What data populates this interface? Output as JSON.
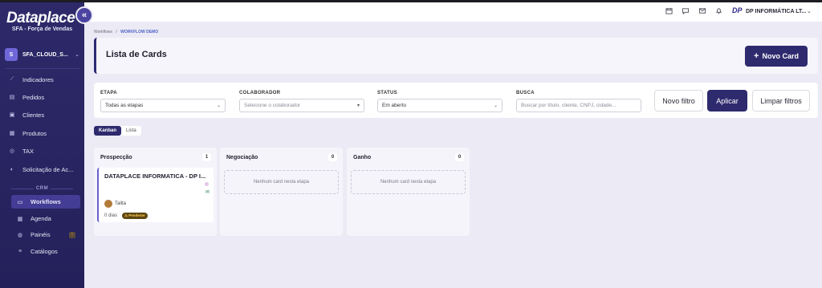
{
  "brand": {
    "logo": "Dataplace",
    "subtitle": "SFA - Força de Vendas",
    "collapse_icon": "«"
  },
  "account": {
    "initial": "S",
    "name": "SFA_CLOUD_S...",
    "chevron": "⌄"
  },
  "nav": [
    {
      "label": "Indicadores",
      "icon": "chart-icon",
      "glyph": "⟋"
    },
    {
      "label": "Pedidos",
      "icon": "document-icon",
      "glyph": "▤"
    },
    {
      "label": "Clientes",
      "icon": "clients-icon",
      "glyph": "▣"
    },
    {
      "label": "Produtos",
      "icon": "products-icon",
      "glyph": "▦"
    },
    {
      "label": "TAX",
      "icon": "globe-icon",
      "glyph": "◎"
    },
    {
      "label": "Solicitação de Ac...",
      "icon": "shield-icon",
      "glyph": "◐"
    }
  ],
  "crm": {
    "label": "CRM",
    "items": [
      {
        "label": "Workflows",
        "icon": "workflow-icon",
        "glyph": "▭",
        "active": true
      },
      {
        "label": "Agenda",
        "icon": "calendar-icon",
        "glyph": "▦"
      },
      {
        "label": "Painéis",
        "icon": "panels-icon",
        "glyph": "◍",
        "badge": "!"
      },
      {
        "label": "Catálogos",
        "icon": "list-icon",
        "glyph": "≡"
      }
    ]
  },
  "topbar": {
    "icons": [
      "calendar-icon",
      "chat-icon",
      "mail-icon",
      "bell-icon"
    ],
    "logo": "DP",
    "company": "DP INFORMÁTICA LT...",
    "chevron": "⌄"
  },
  "breadcrumb": {
    "root": "Workflows",
    "separator": "/",
    "current": "WORKFLOW DEMO"
  },
  "header": {
    "title": "Lista de Cards",
    "new_card_label": "Novo Card",
    "new_card_icon": "+"
  },
  "filters": {
    "etapa": {
      "label": "ETAPA",
      "value": "Todas as etapas"
    },
    "colaborador": {
      "label": "COLABORADOR",
      "placeholder": "Selecione o colaborador"
    },
    "status": {
      "label": "STATUS",
      "value": "Em aberto"
    },
    "busca": {
      "label": "BUSCA",
      "placeholder": "Buscar por título, cliente, CNPJ, cidade..."
    },
    "buttons": {
      "new_filter": "Novo filtro",
      "apply": "Aplicar",
      "clear": "Limpar filtros"
    }
  },
  "view_toggle": {
    "kanban": "Kanban",
    "list": "Lista",
    "active": "Kanban"
  },
  "columns": [
    {
      "title": "Prospecção",
      "count": "1",
      "cards": [
        {
          "title": "DATAPLACE INFORMATICA - DP I...",
          "user": "Talita",
          "days": "0 dias",
          "status": "⚠ Pendente"
        }
      ]
    },
    {
      "title": "Negociação",
      "count": "0",
      "empty_text": "Nenhum card nesta etapa"
    },
    {
      "title": "Ganho",
      "count": "0",
      "empty_text": "Nenhum card nesta etapa"
    }
  ],
  "colors": {
    "sidebar": "#2e2a6a",
    "primary": "#2e2a6e",
    "accent": "#4d62c8",
    "pending_badge": "#5d4510"
  }
}
